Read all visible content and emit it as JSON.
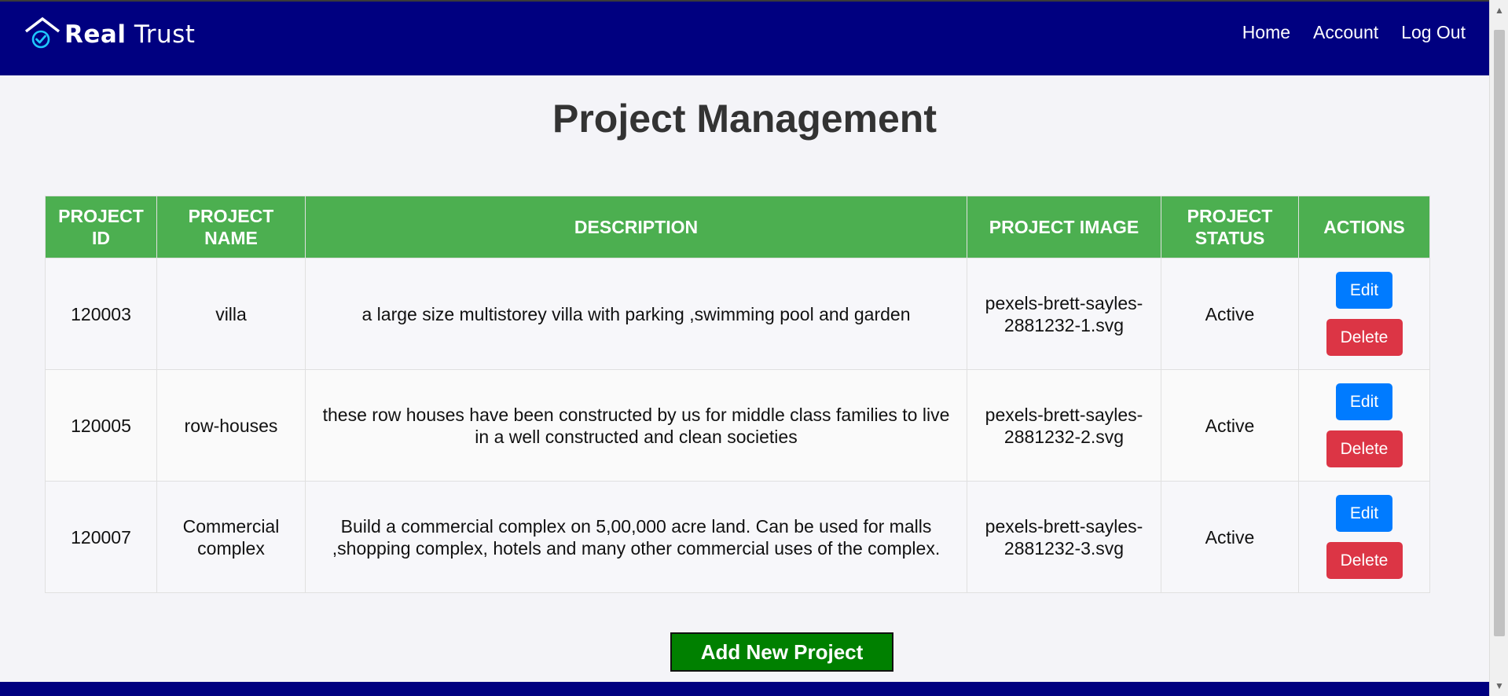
{
  "header": {
    "brand_bold": "Real",
    "brand_light": "Trust",
    "nav": [
      "Home",
      "Account",
      "Log Out"
    ]
  },
  "page": {
    "title": "Project Management"
  },
  "table": {
    "columns": [
      "PROJECT ID",
      "PROJECT NAME",
      "DESCRIPTION",
      "PROJECT IMAGE",
      "PROJECT STATUS",
      "ACTIONS"
    ],
    "rows": [
      {
        "id": "120003",
        "name": "villa",
        "description": "a large size multistorey villa with parking ,swimming pool and garden",
        "image": "pexels-brett-sayles-2881232-1.svg",
        "status": "Active"
      },
      {
        "id": "120005",
        "name": "row-houses",
        "description": "these row houses have been constructed by us for middle class families to live in a well constructed and clean societies",
        "image": "pexels-brett-sayles-2881232-2.svg",
        "status": "Active"
      },
      {
        "id": "120007",
        "name": "Commercial complex",
        "description": "Build a commercial complex on 5,00,000 acre land. Can be used for malls ,shopping complex, hotels and many other commercial uses of the complex.",
        "image": "pexels-brett-sayles-2881232-3.svg",
        "status": "Active"
      }
    ],
    "edit_label": "Edit",
    "delete_label": "Delete"
  },
  "actions": {
    "add_label": "Add New Project"
  },
  "colors": {
    "header_bg": "#000080",
    "table_header_bg": "#4caf50",
    "edit_button": "#007bff",
    "delete_button": "#dc3545",
    "add_button": "#008000"
  },
  "icons": {
    "logo": "house-check-icon"
  }
}
